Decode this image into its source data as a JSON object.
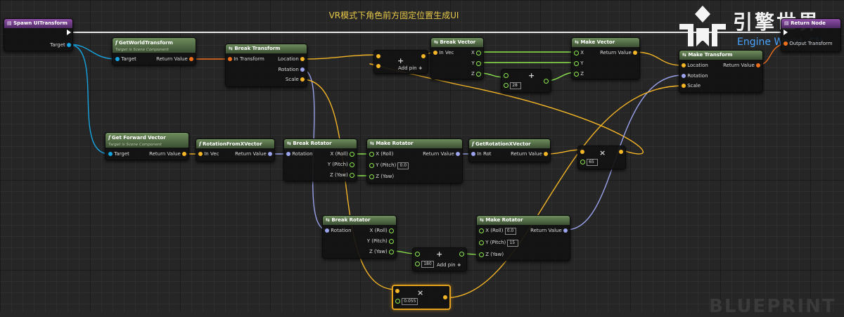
{
  "title": "VR模式下角色前方固定位置生成UI",
  "logo": {
    "cn": "引擎世界",
    "en": "Engine World .CN"
  },
  "watermark": "BLUEPRINT",
  "nodes": {
    "spawn": {
      "title": "Spawn UITransform",
      "target": "Target"
    },
    "get_world_transform": {
      "title": "GetWorldTransform",
      "subtitle": "Target is Scene Component",
      "target": "Target",
      "ret": "Return Value"
    },
    "break_transform": {
      "title": "Break Transform",
      "in": "In Transform",
      "location": "Location",
      "rotation": "Rotation",
      "scale": "Scale"
    },
    "add_vec": {
      "add_pin": "Add pin",
      "plus": "+"
    },
    "break_vector": {
      "title": "Break Vector",
      "in": "In Vec",
      "x": "X",
      "y": "Y",
      "z": "Z"
    },
    "add_z": {
      "value": "28",
      "plus": "+"
    },
    "make_vector": {
      "title": "Make Vector",
      "x": "X",
      "y": "Y",
      "z": "Z",
      "ret": "Return Value"
    },
    "make_transform": {
      "title": "Make Transform",
      "location": "Location",
      "rotation": "Rotation",
      "scale": "Scale",
      "ret": "Return Value"
    },
    "return_node": {
      "title": "Return Node",
      "out": "Output Transform"
    },
    "get_forward": {
      "title": "Get Forward Vector",
      "subtitle": "Target is Scene Component",
      "target": "Target",
      "ret": "Return Value"
    },
    "rot_from_x": {
      "title": "RotationFromXVector",
      "in": "In Vec",
      "ret": "Return Value"
    },
    "break_rot1": {
      "title": "Break Rotator",
      "rotation": "Rotation",
      "x": "X (Roll)",
      "y": "Y (Pitch)",
      "z": "Z (Yaw)"
    },
    "make_rot1": {
      "title": "Make Rotator",
      "x": "X (Roll)",
      "y": "Y (Pitch)",
      "y_val": "0.0",
      "z": "Z (Yaw)",
      "ret": "Return Value"
    },
    "get_rot_x": {
      "title": "GetRotationXVector",
      "in": "In Rot",
      "ret": "Return Value"
    },
    "mul65": {
      "value": "65",
      "op": "×"
    },
    "break_rot2": {
      "title": "Break Rotator",
      "rotation": "Rotation",
      "x": "X (Roll)",
      "y": "Y (Pitch)",
      "z": "Z (Yaw)"
    },
    "add180": {
      "value": "180",
      "add_pin": "Add pin",
      "plus": "+"
    },
    "make_rot2": {
      "title": "Make Rotator",
      "x": "X (Roll)",
      "x_val": "0.0",
      "y": "Y (Pitch)",
      "y_val": "15",
      "z": "Z (Yaw)",
      "ret": "Return Value"
    },
    "mul055": {
      "value": "0.055",
      "op": "×"
    }
  },
  "colors": {
    "vector": "#f4b526",
    "rotator": "#9aa3ec",
    "transform": "#ee6f1c",
    "object": "#16a4e0",
    "float": "#8ee84e",
    "exec": "#ffffff",
    "selection": "#e5a21c"
  }
}
